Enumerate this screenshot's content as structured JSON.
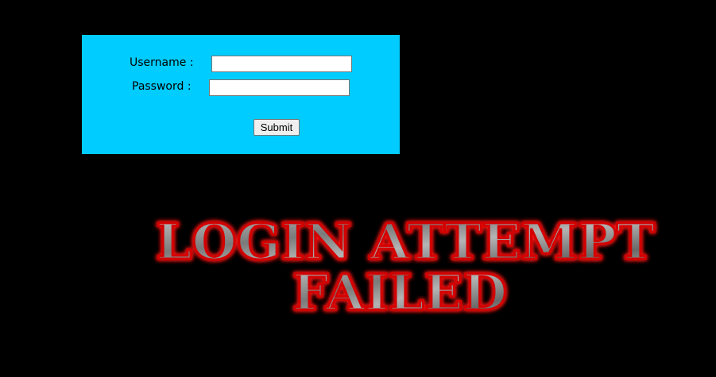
{
  "login_form": {
    "username_label": "Username :",
    "password_label": "Password :",
    "username_value": "",
    "password_value": "",
    "submit_label": "Submit",
    "panel_color": "#00ccff"
  },
  "banner": {
    "line1": "LOGIN ATTEMPT",
    "line2": "FAILED",
    "glow_color": "#ff0000",
    "text_color": "#8a8a8a"
  }
}
